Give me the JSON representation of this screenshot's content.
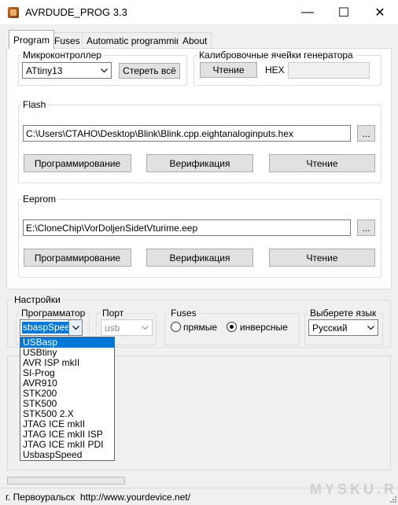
{
  "window": {
    "title": "AVRDUDE_PROG 3.3",
    "minimize_glyph": "—",
    "maximize_glyph": "☐",
    "close_glyph": "✕"
  },
  "tabs": [
    {
      "label": "Program"
    },
    {
      "label": "Fuses"
    },
    {
      "label": "Automatic programming"
    },
    {
      "label": "About"
    }
  ],
  "mcu": {
    "group_label": "Микроконтроллер",
    "selected": "ATtiny13",
    "erase_label": "Стереть всё"
  },
  "calib": {
    "group_label": "Калибровочные ячейки генератора",
    "read_label": "Чтение",
    "hex_label": "HEX",
    "hex_value": ""
  },
  "flash": {
    "group_label": "Flash",
    "path": "C:\\Users\\СТАНО\\Desktop\\Blink\\Blink.cpp.eightanaloginputs.hex",
    "browse_label": "...",
    "program_label": "Программирование",
    "verify_label": "Верификация",
    "read_label": "Чтение"
  },
  "eeprom": {
    "group_label": "Eeprom",
    "path": "E:\\CloneChip\\VorDoljenSidetVturime.eep",
    "browse_label": "...",
    "program_label": "Программирование",
    "verify_label": "Верификация",
    "read_label": "Чтение"
  },
  "settings": {
    "group_label": "Настройки",
    "programmer_label": "Программатор",
    "programmer_value": "sbaspSpeed",
    "port_label": "Порт",
    "port_value": "usb",
    "fuses_label": "Fuses",
    "fuses_direct": "прямые",
    "fuses_inverse": "инверсные",
    "language_label": "Выберете язык",
    "language_value": "Русский"
  },
  "programmer_options": [
    "USBasp",
    "USBtiny",
    "AVR ISP mkII",
    "SI-Prog",
    "AVR910",
    "STK200",
    "STK500",
    "STK500 2.X",
    "JTAG ICE mkII",
    "JTAG ICE mkII ISP",
    "JTAG ICE mkII PDI",
    "UsbaspSpeed"
  ],
  "status": {
    "city": "г. Первоуральск",
    "url": "http://www.yourdevice.net/",
    "progress": 0
  },
  "watermark": "MYSKU.RU"
}
